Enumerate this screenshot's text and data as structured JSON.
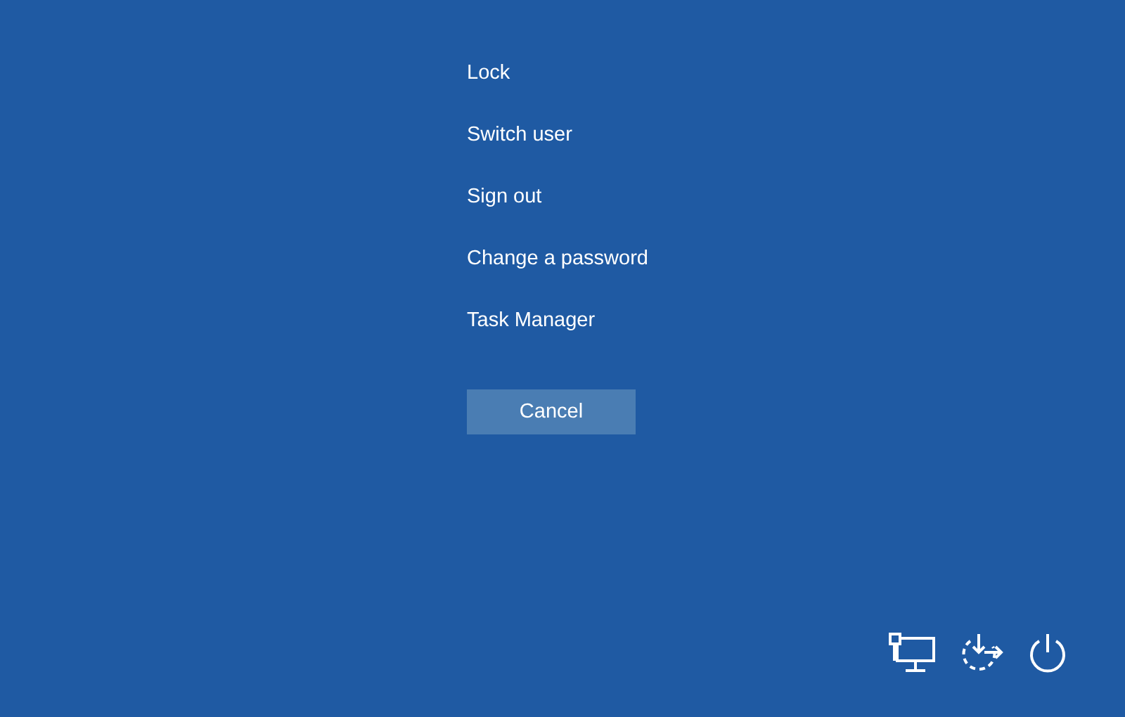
{
  "menu": [
    {
      "label": "Lock"
    },
    {
      "label": "Switch user"
    },
    {
      "label": "Sign out"
    },
    {
      "label": "Change a password"
    },
    {
      "label": "Task Manager"
    }
  ],
  "cancel": "Cancel",
  "tray": [
    {
      "kind": "network"
    },
    {
      "kind": "accessibility"
    },
    {
      "kind": "power"
    }
  ]
}
